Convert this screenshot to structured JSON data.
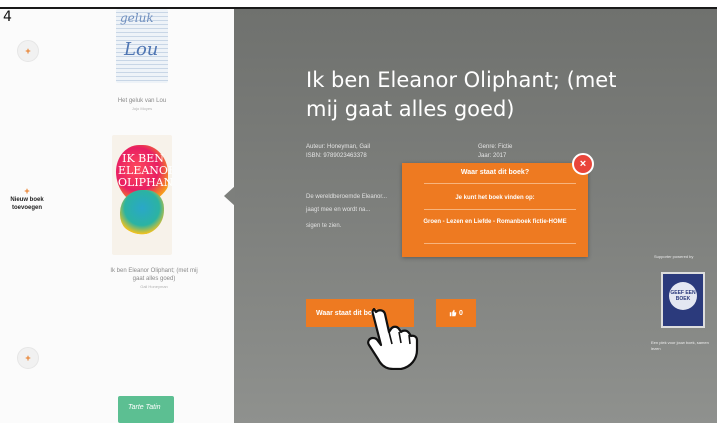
{
  "slide_number": "4",
  "sidebar": {
    "new_book_label": "Nieuw boek\ntoevoegen",
    "plus_glyph": "+"
  },
  "books": [
    {
      "cover_title_1": "geluk",
      "cover_title_2": "Lou",
      "caption": "Het geluk van Lou",
      "caption_sub": "Jojo Moyes"
    },
    {
      "cover_title": "IK BEN ELEANOR OLIPHANT",
      "caption": "Ik ben Eleanor Oliphant; (met mij gaat alles goed)",
      "caption_sub": "Gail Honeyman"
    },
    {
      "cover_title": "Tarte Tatin"
    }
  ],
  "detail": {
    "title": "Ik ben Eleanor Oliphant; (met mij gaat alles goed)",
    "author": "Auteur: Honeyman, Gail",
    "isbn": "ISBN: 9789023463378",
    "genre": "Genre: Fictie",
    "year": "Jaar: 2017",
    "description_1": "De wereldberoemde Eleanor...",
    "description_2": "jaagt mee en wordt na...",
    "description_3": "sigen te zien."
  },
  "popup": {
    "heading": "Waar staat dit boek?",
    "option_1": "Je kunt het boek vinden op:",
    "option_2": "Groen - Lezen en Liefde - Romanboek fictie-HOME",
    "close_glyph": "×"
  },
  "buttons": {
    "where_label": "Waar staat dit boek?",
    "like_count": "0",
    "like_icon": "thumbs-up-icon"
  },
  "sponsor": {
    "label": "Supporter powered by",
    "logo_text": "GEEF EEN BOEK",
    "caption": "Een plek voor jouw boek, samen lezen"
  },
  "colors": {
    "accent": "#ee7a21",
    "panel": "#7b7d7a",
    "close": "#e9453a"
  }
}
